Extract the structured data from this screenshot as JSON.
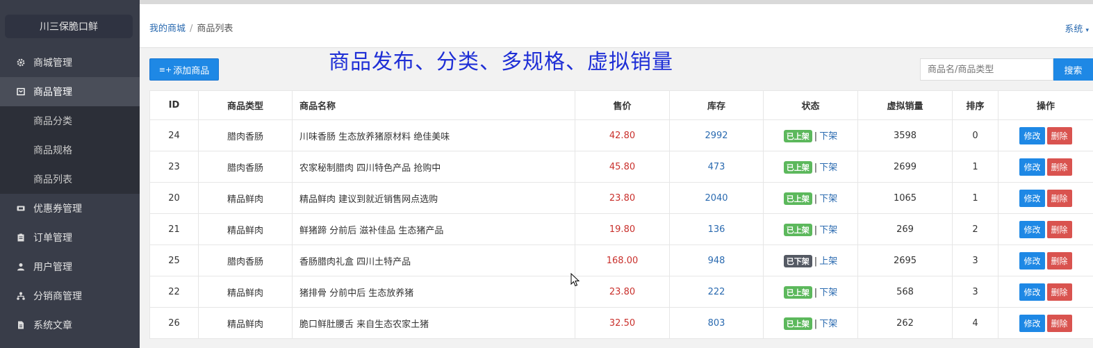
{
  "sidebar": {
    "brand": "川三保脆口鲜",
    "items": [
      {
        "label": "商城管理",
        "icon": "gear-icon"
      },
      {
        "label": "商品管理",
        "icon": "box-icon",
        "active": true
      },
      {
        "label": "商品分类",
        "sub": true
      },
      {
        "label": "商品规格",
        "sub": true
      },
      {
        "label": "商品列表",
        "sub": true
      },
      {
        "label": "优惠券管理",
        "icon": "coupon-icon"
      },
      {
        "label": "订单管理",
        "icon": "clipboard-icon"
      },
      {
        "label": "用户管理",
        "icon": "user-icon"
      },
      {
        "label": "分销商管理",
        "icon": "sitemap-icon"
      },
      {
        "label": "系统文章",
        "icon": "document-icon"
      }
    ]
  },
  "header": {
    "breadcrumb_home": "我的商城",
    "breadcrumb_sep": "/",
    "breadcrumb_current": "商品列表",
    "system_menu": "系统"
  },
  "toolbar": {
    "add_label": "添加商品",
    "overlay_text": "商品发布、分类、多规格、虚拟销量",
    "search_placeholder": "商品名/商品类型",
    "search_label": "搜索"
  },
  "table": {
    "columns": [
      "ID",
      "商品类型",
      "商品名称",
      "售价",
      "库存",
      "状态",
      "虚拟销量",
      "排序",
      "操作"
    ],
    "rows": [
      {
        "id": "24",
        "type": "腊肉香肠",
        "name": "川味香肠 生态放养猪原材料 绝佳美味",
        "price": "42.80",
        "stock": "2992",
        "status": "已上架",
        "status_on": true,
        "toggle": "下架",
        "virtual_sales": "3598",
        "sort": "0"
      },
      {
        "id": "23",
        "type": "腊肉香肠",
        "name": "农家秘制腊肉 四川特色产品 抢购中",
        "price": "45.80",
        "stock": "473",
        "status": "已上架",
        "status_on": true,
        "toggle": "下架",
        "virtual_sales": "2699",
        "sort": "1"
      },
      {
        "id": "20",
        "type": "精品鲜肉",
        "name": "精品鲜肉 建议到就近销售网点选购",
        "price": "23.80",
        "stock": "2040",
        "status": "已上架",
        "status_on": true,
        "toggle": "下架",
        "virtual_sales": "1065",
        "sort": "1"
      },
      {
        "id": "21",
        "type": "精品鲜肉",
        "name": "鲜猪蹄 分前后 滋补佳品 生态猪产品",
        "price": "19.80",
        "stock": "136",
        "status": "已上架",
        "status_on": true,
        "toggle": "下架",
        "virtual_sales": "269",
        "sort": "2"
      },
      {
        "id": "25",
        "type": "腊肉香肠",
        "name": "香肠腊肉礼盒 四川土特产品",
        "price": "168.00",
        "stock": "948",
        "status": "已下架",
        "status_on": false,
        "toggle": "上架",
        "virtual_sales": "2695",
        "sort": "3"
      },
      {
        "id": "22",
        "type": "精品鲜肉",
        "name": "猪排骨 分前中后 生态放养猪",
        "price": "23.80",
        "stock": "222",
        "status": "已上架",
        "status_on": true,
        "toggle": "下架",
        "virtual_sales": "568",
        "sort": "3"
      },
      {
        "id": "26",
        "type": "精品鲜肉",
        "name": "脆口鲜肚腰舌 来自生态农家土猪",
        "price": "32.50",
        "stock": "803",
        "status": "已上架",
        "status_on": true,
        "toggle": "下架",
        "virtual_sales": "262",
        "sort": "4"
      }
    ],
    "edit_label": "修改",
    "delete_label": "删除"
  },
  "colors": {
    "primary": "#1e88e5",
    "danger": "#d9534f",
    "success": "#5cb85c",
    "sidebar": "#393d49"
  }
}
